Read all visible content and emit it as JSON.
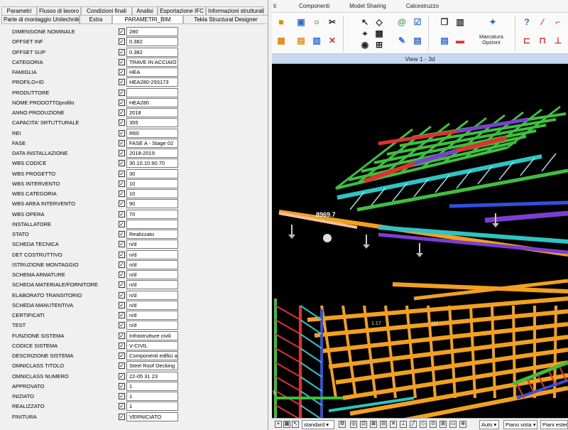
{
  "dialog": {
    "tabs_row1": [
      "Parametri",
      "Flusso di lavoro",
      "Condizioni finali",
      "Analisi",
      "Esportazione IFC",
      "Informazioni strutturali"
    ],
    "tabs_row2": [
      "Parte di montaggio Unitechnik",
      "Extra",
      "PARAMETRI_BIM",
      "Tekla Structural Designer"
    ],
    "active_tab": "PARAMETRI_BIM",
    "check_mark": "✓",
    "properties": [
      {
        "label": "DIMENSIONE NOMINALE",
        "value": "280"
      },
      {
        "label": "OFFSET INF",
        "value": "0.382"
      },
      {
        "label": "OFFSET SUP",
        "value": "0.382"
      },
      {
        "label": "CATEGORIA",
        "value": "TRAVE IN ACCIAIO"
      },
      {
        "label": "FAMIGLIA",
        "value": "HEA"
      },
      {
        "label": "PROFILO+ID",
        "value": "HEA280-293173"
      },
      {
        "label": "PRODUTTORE",
        "value": ""
      },
      {
        "label": "NOME PRODOTTOprofilo",
        "value": "HEA280"
      },
      {
        "label": "ANNO PRODUZIONE",
        "value": "2018"
      },
      {
        "label": "CAPACITA' SRTUTTURALE",
        "value": "355"
      },
      {
        "label": "REI",
        "value": "R60"
      },
      {
        "label": "FASE",
        "value": "FASE A - Stage 02"
      },
      {
        "label": "DATA INSTALLAZIONE",
        "value": "2018-2019"
      },
      {
        "label": "WBS CODICE",
        "value": "30.10.10.90.70"
      },
      {
        "label": "WBS PROGETTO",
        "value": "30"
      },
      {
        "label": "WBS INTERVENTO",
        "value": "10"
      },
      {
        "label": "WBS CATEGORIA",
        "value": "10"
      },
      {
        "label": "WBS AREA INTERVENTO",
        "value": "90"
      },
      {
        "label": "WBS OPERA",
        "value": "70"
      },
      {
        "label": "INSTALLATORE",
        "value": ""
      },
      {
        "label": "STATO",
        "value": "Realizzato"
      },
      {
        "label": "SCHEDA TECNICA",
        "value": "n/d"
      },
      {
        "label": "DET COSTRUTTIVO",
        "value": "n/d"
      },
      {
        "label": "ISTRUZIONE MONTAGGIO",
        "value": "n/d"
      },
      {
        "label": "SCHEMA ARMATURE",
        "value": "n/d"
      },
      {
        "label": "SCHEDA MATERIALE/FORNITORE",
        "value": "n/d"
      },
      {
        "label": "ELABORATO TRANSITORIO",
        "value": "n/d"
      },
      {
        "label": "SCHEDA MANUTENTIVA",
        "value": "n/d"
      },
      {
        "label": "CERTIFICATI",
        "value": "n/d"
      },
      {
        "label": "TEST",
        "value": "n/d"
      },
      {
        "label": "FUNZIONE SISTEMA",
        "value": "Infrastrutture civili"
      },
      {
        "label": "CODICE SISTEMA",
        "value": "V-CIVIL"
      },
      {
        "label": "DESCRIZIONE SISTEMA",
        "value": "Componenti edifici a"
      },
      {
        "label": "OMNICLASS TITOLO",
        "value": "Steel Roof Decking"
      },
      {
        "label": "OMNICLASS NUMERO",
        "value": "22-05 31 23"
      },
      {
        "label": "APPROVATO",
        "value": "1"
      },
      {
        "label": "INIZIATO",
        "value": "1"
      },
      {
        "label": "REALIZZATO",
        "value": "1"
      },
      {
        "label": "FINITURA",
        "value": "VERNICIATO"
      }
    ]
  },
  "app": {
    "ribbon_tabs": [
      "ti",
      "Componenti",
      "Model Sharing",
      "Calcestruzzo"
    ],
    "marcatura_label": "Marcatura\nOpzioni",
    "view_title": "View 1 - 3d",
    "dimension_label": "8969.7",
    "grid_label_a": "1.17",
    "grid_label_b": "1M",
    "left_number": "9",
    "status": {
      "standard_select": "standard",
      "auto_select": "Auto",
      "piano_select": "Piano vista",
      "piani_select": "Piani ester"
    }
  },
  "colors": {
    "viewport_bg": "#000000",
    "beam_green": "#3fbf3f",
    "beam_cyan": "#2ec4c4",
    "beam_red": "#e03030",
    "beam_purple": "#7a3fd1",
    "beam_orange": "#f2a020",
    "beam_blue": "#3050e0",
    "view_title_bg": "#c5daf0"
  }
}
